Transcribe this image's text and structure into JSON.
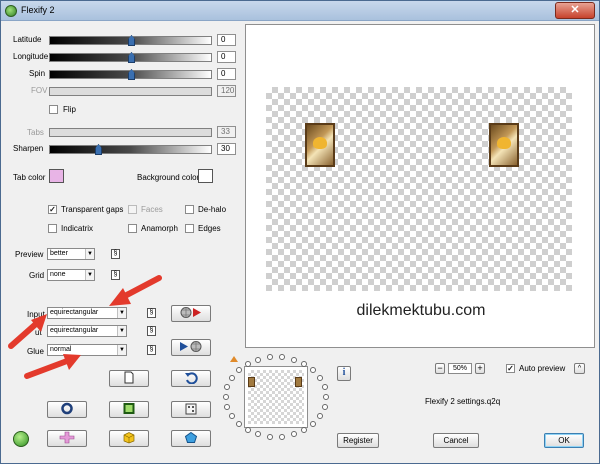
{
  "window": {
    "title": "Flexify 2",
    "close_glyph": "✕"
  },
  "sliders": [
    {
      "label": "Latitude",
      "value": "0",
      "pos": 0.5,
      "enabled": true
    },
    {
      "label": "Longitude",
      "value": "0",
      "pos": 0.5,
      "enabled": true
    },
    {
      "label": "Spin",
      "value": "0",
      "pos": 0.5,
      "enabled": true
    },
    {
      "label": "FOV",
      "value": "120",
      "pos": 0.0,
      "enabled": false
    }
  ],
  "flip_label": "Flip",
  "tabs_slider": {
    "label": "Tabs",
    "value": "33"
  },
  "sharpen_slider": {
    "label": "Sharpen",
    "value": "30",
    "pos": 0.3
  },
  "tab_color": {
    "label": "Tab color",
    "color": "#e8b4e6"
  },
  "background_color": {
    "label": "Background color",
    "color": "#ffffff"
  },
  "checkboxes": {
    "transparent_gaps": {
      "label": "Transparent gaps",
      "checked": true
    },
    "faces": {
      "label": "Faces",
      "checked": false
    },
    "de_halo": {
      "label": "De-halo",
      "checked": false
    },
    "indicatrix": {
      "label": "Indicatrix",
      "checked": false
    },
    "anamorph": {
      "label": "Anamorph",
      "checked": false
    },
    "edges": {
      "label": "Edges",
      "checked": false
    },
    "auto_preview": {
      "label": "Auto preview",
      "checked": true
    }
  },
  "preview_select": {
    "label": "Preview",
    "value": "better"
  },
  "grid_select": {
    "label": "Grid",
    "value": "none"
  },
  "input_select": {
    "label": "Input",
    "value": "equirectangular"
  },
  "output_select": {
    "label": "ut",
    "value": "equirectangular"
  },
  "glue_select": {
    "label": "Glue",
    "value": "normal"
  },
  "zoom": {
    "value": "50%",
    "minus": "−",
    "plus": "+"
  },
  "watermark": "dilekmektubu.com",
  "settings_file": "Flexify 2 settings.q2q",
  "buttons": {
    "register": "Register",
    "cancel": "Cancel",
    "ok": "OK",
    "info": "i",
    "expand": "^"
  },
  "colors": {
    "arrow_red": "#e33a2c",
    "accent_blue": "#3a6fb0"
  }
}
